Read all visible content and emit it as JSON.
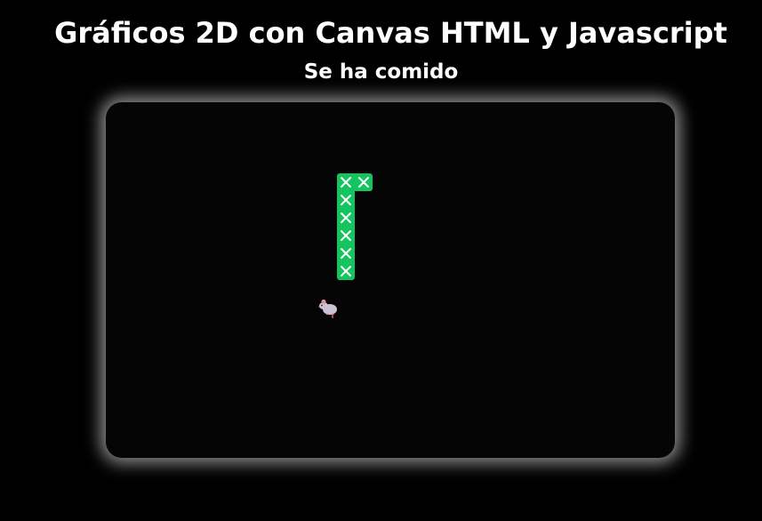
{
  "header": {
    "title": "Gráficos 2D con Canvas HTML y Javascript",
    "status": "Se ha comido"
  },
  "game": {
    "grid_cols": 32,
    "grid_rows": 20,
    "snake_color": "#14c45e",
    "snake_mark_color": "#ffffff",
    "board_color": "#050505",
    "glow_color": "#ffffff",
    "snake": [
      {
        "col": 13,
        "row": 4
      },
      {
        "col": 14,
        "row": 4
      },
      {
        "col": 13,
        "row": 5
      },
      {
        "col": 13,
        "row": 6
      },
      {
        "col": 13,
        "row": 7
      },
      {
        "col": 13,
        "row": 8
      },
      {
        "col": 13,
        "row": 9
      }
    ],
    "food": {
      "col": 12,
      "row": 11,
      "icon": "mouse-icon"
    }
  }
}
